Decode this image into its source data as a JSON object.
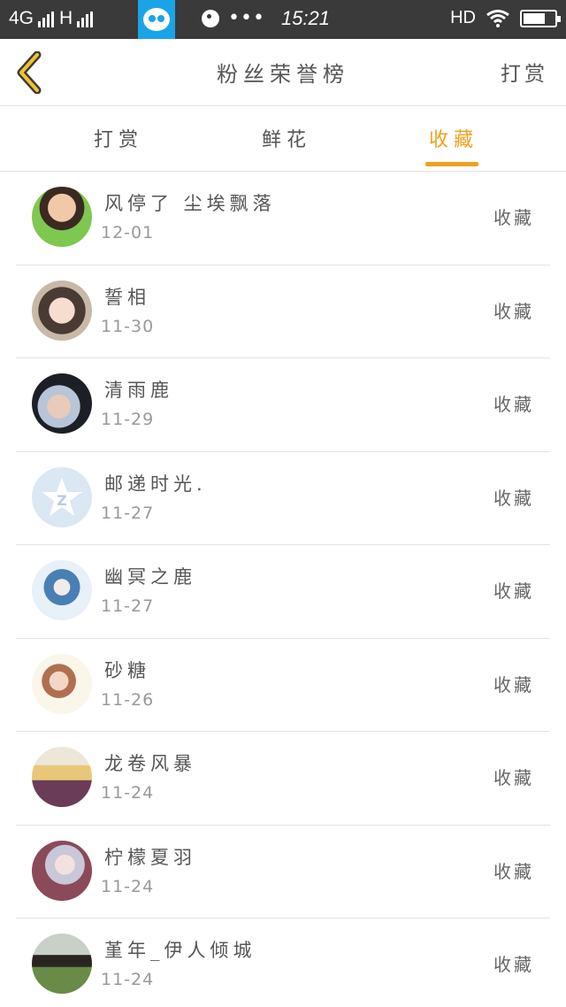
{
  "status_bar": {
    "network": "4G",
    "network2": "H",
    "app_badge": "vivo",
    "time": "15:21",
    "hd": "HD"
  },
  "header": {
    "title": "粉丝荣誉榜",
    "action": "打赏"
  },
  "tabs": [
    {
      "label": "打赏",
      "active": false
    },
    {
      "label": "鲜花",
      "active": false
    },
    {
      "label": "收藏",
      "active": true
    }
  ],
  "accent_color": "#f0a020",
  "list": [
    {
      "name": "风停了 尘埃飘落",
      "date": "12-01",
      "action": "收藏"
    },
    {
      "name": "誓相",
      "date": "11-30",
      "action": "收藏"
    },
    {
      "name": "清雨鹿",
      "date": "11-29",
      "action": "收藏"
    },
    {
      "name": "邮递时光.",
      "date": "11-27",
      "action": "收藏"
    },
    {
      "name": "幽冥之鹿",
      "date": "11-27",
      "action": "收藏"
    },
    {
      "name": "砂糖",
      "date": "11-26",
      "action": "收藏"
    },
    {
      "name": "龙卷风暴",
      "date": "11-24",
      "action": "收藏"
    },
    {
      "name": "柠檬夏羽",
      "date": "11-24",
      "action": "收藏"
    },
    {
      "name": "堇年_伊人倾城",
      "date": "11-24",
      "action": "收藏"
    }
  ]
}
